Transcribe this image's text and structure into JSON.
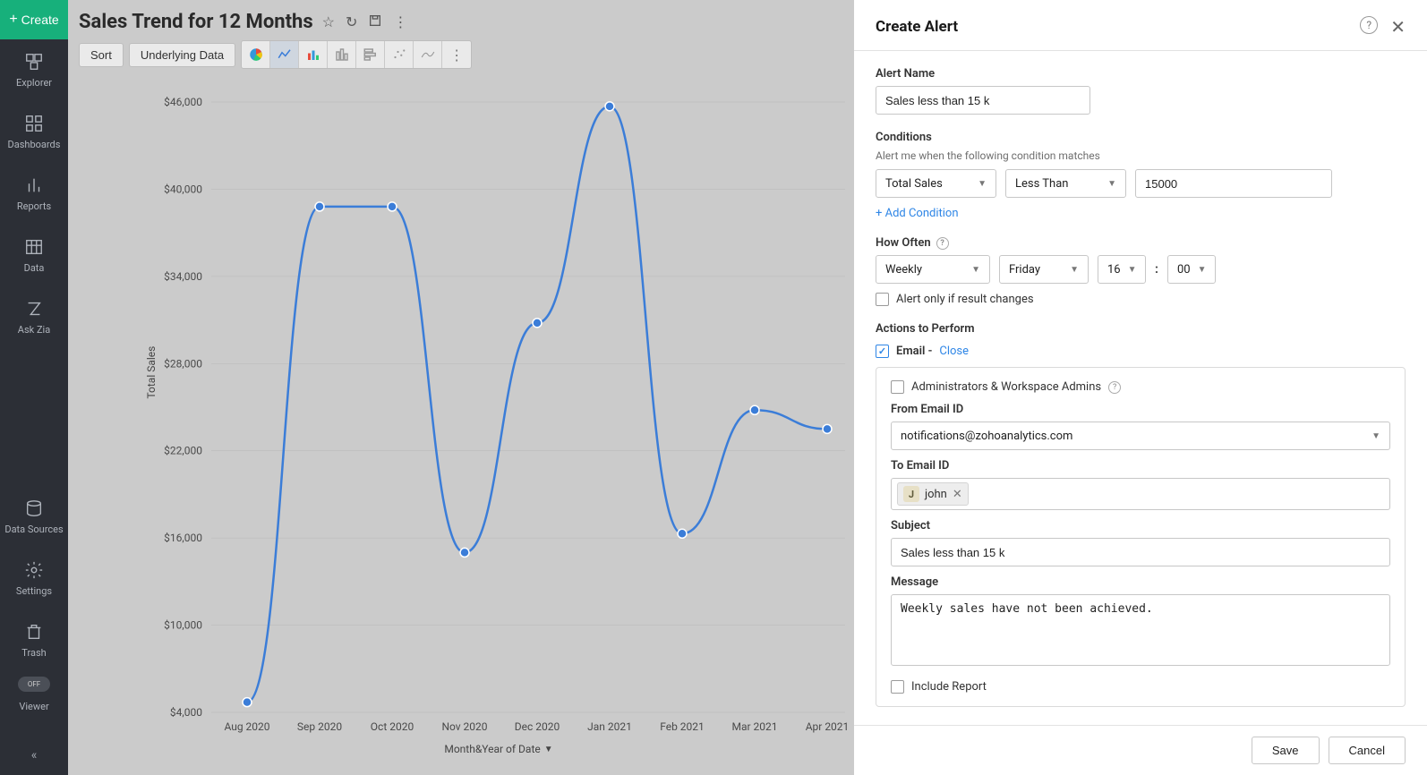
{
  "sidebar": {
    "create_label": "Create",
    "items": [
      {
        "label": "Explorer"
      },
      {
        "label": "Dashboards"
      },
      {
        "label": "Reports"
      },
      {
        "label": "Data"
      },
      {
        "label": "Ask Zia"
      }
    ],
    "bottom_items": [
      {
        "label": "Data Sources"
      },
      {
        "label": "Settings"
      },
      {
        "label": "Trash"
      }
    ],
    "viewer_toggle": "OFF",
    "viewer_label": "Viewer"
  },
  "page": {
    "title": "Sales Trend for 12 Months",
    "toolbar": {
      "sort": "Sort",
      "underlying": "Underlying Data"
    },
    "y_axis_title": "Total Sales",
    "x_axis_title": "Month&Year of Date"
  },
  "chart_data": {
    "type": "line",
    "xlabel": "Month&Year of Date",
    "ylabel": "Total Sales",
    "y_ticks": [
      "$4,000",
      "$10,000",
      "$16,000",
      "$22,000",
      "$28,000",
      "$34,000",
      "$40,000",
      "$46,000"
    ],
    "ylim": [
      4000,
      46000
    ],
    "categories": [
      "Aug 2020",
      "Sep 2020",
      "Oct 2020",
      "Nov 2020",
      "Dec 2020",
      "Jan 2021",
      "Feb 2021",
      "Mar 2021",
      "Apr 2021"
    ],
    "values": [
      4700,
      38800,
      38800,
      15000,
      30800,
      45700,
      16300,
      24800,
      23500
    ]
  },
  "modal": {
    "title": "Create Alert",
    "alert_name_label": "Alert Name",
    "alert_name_value": "Sales less than 15 k",
    "conditions_label": "Conditions",
    "conditions_sub": "Alert me when the following condition matches",
    "cond_field": "Total Sales",
    "cond_op": "Less Than",
    "cond_value": "15000",
    "add_condition": "+ Add Condition",
    "how_often_label": "How Often",
    "freq": "Weekly",
    "day": "Friday",
    "hour": "16",
    "minute": "00",
    "only_if_changes": "Alert only if result changes",
    "actions_label": "Actions to Perform",
    "email_label": "Email",
    "email_close": "Close",
    "admins_label": "Administrators & Workspace Admins",
    "from_label": "From Email ID",
    "from_value": "notifications@zohoanalytics.com",
    "to_label": "To Email ID",
    "to_token_initial": "J",
    "to_token_name": "john",
    "subject_label": "Subject",
    "subject_value": "Sales less than 15 k",
    "message_label": "Message",
    "message_value": "Weekly sales have not been achieved.",
    "include_report": "Include Report",
    "save": "Save",
    "cancel": "Cancel"
  }
}
